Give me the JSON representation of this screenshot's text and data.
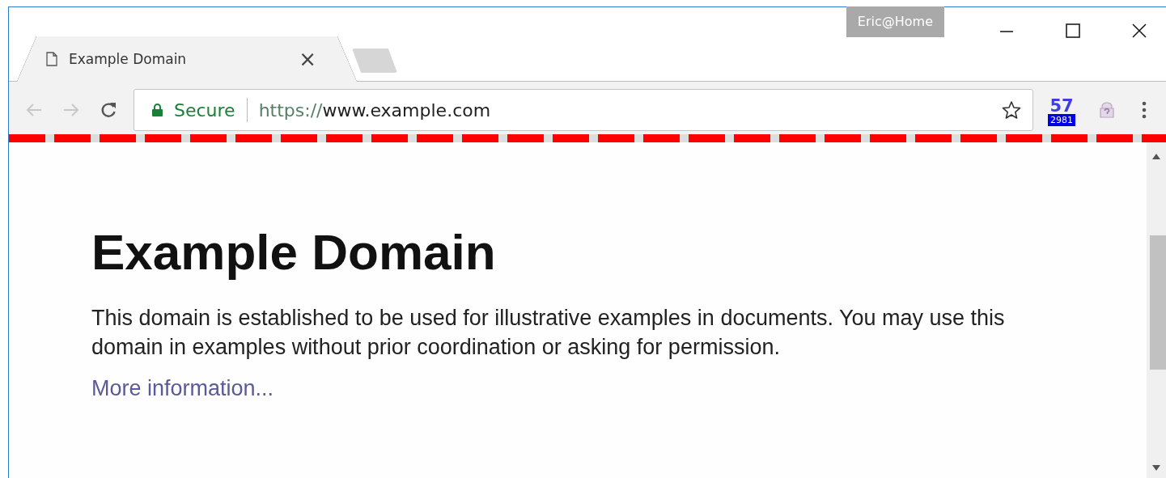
{
  "window": {
    "user_badge": "Eric@Home"
  },
  "tabs": [
    {
      "title": "Example Domain",
      "close": "×",
      "selected": true
    }
  ],
  "toolbar": {
    "nav": [
      {
        "kind": "back",
        "disabled": true
      },
      {
        "kind": "forward",
        "disabled": true
      },
      {
        "kind": "reload",
        "disabled": false
      }
    ],
    "address": {
      "security": "Secure",
      "scheme": "https://",
      "host": "www.example.com"
    },
    "extension": {
      "count": "57",
      "badge": "2981"
    }
  },
  "page": {
    "heading": "Example Domain",
    "paragraph": "This domain is established to be used for illustrative examples in documents. You may use this domain in examples without prior coordination or asking for permission.",
    "link": "More information..."
  }
}
